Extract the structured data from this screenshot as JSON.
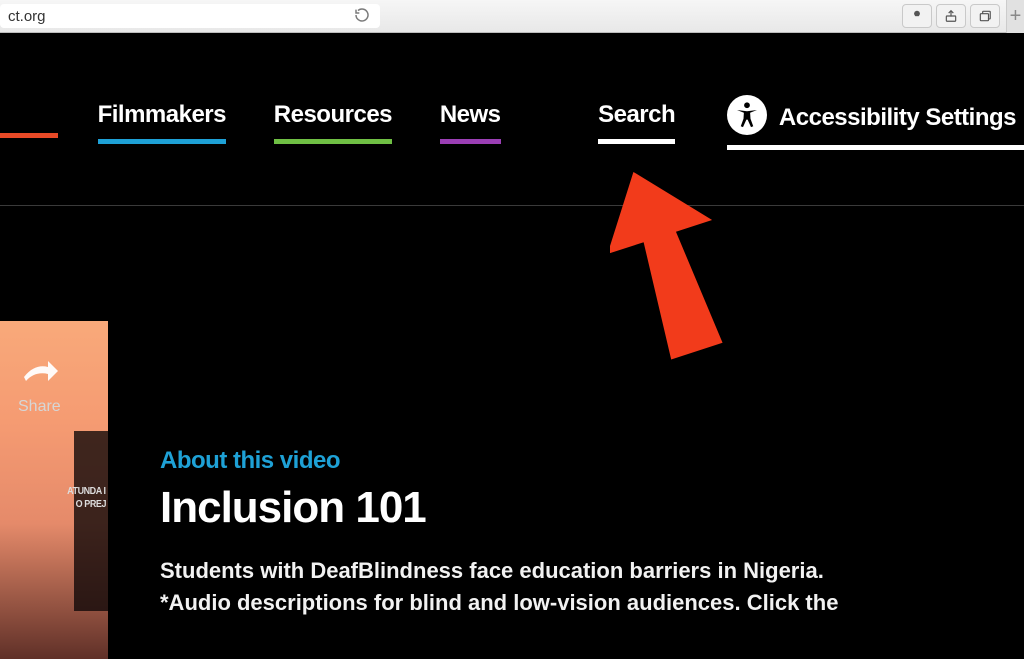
{
  "browser": {
    "url_fragment": "ct.org",
    "new_tab": "+"
  },
  "nav": {
    "filmmakers": "Filmmakers",
    "resources": "Resources",
    "news": "News",
    "search": "Search",
    "accessibility": "Accessibility Settings"
  },
  "video": {
    "share_label": "Share",
    "thumb_text_a": "ATUNDA I",
    "thumb_text_b": "O PREJ"
  },
  "content": {
    "eyebrow": "About this video",
    "title": "Inclusion 101",
    "description": "Students with DeafBlindness face education barriers in Nigeria. *Audio descriptions for blind and low-vision audiences. Click the"
  }
}
